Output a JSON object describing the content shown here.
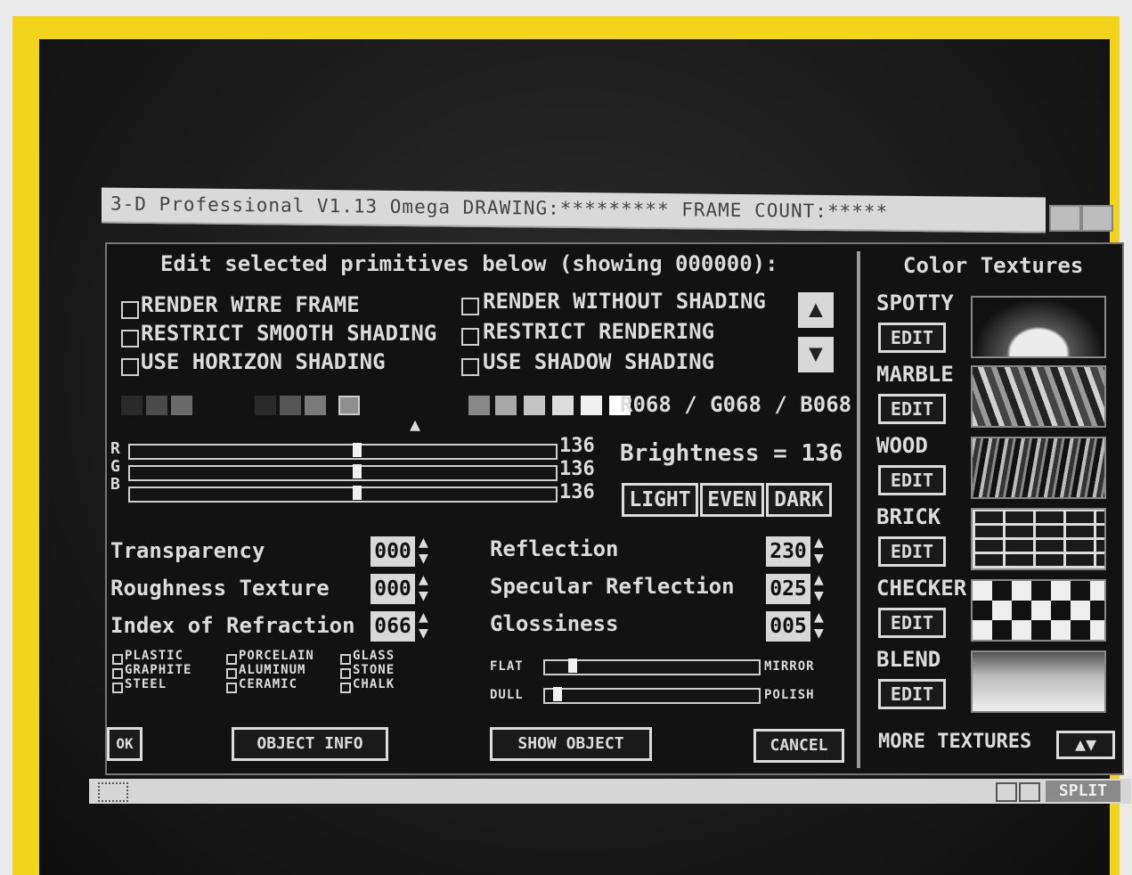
{
  "window": {
    "title": "3-D Professional V1.13 Omega  DRAWING:*********  FRAME COUNT:*****"
  },
  "header": "Edit selected primitives below (showing 000000):",
  "render_options": [
    {
      "label": "RENDER WIRE FRAME",
      "checked": false
    },
    {
      "label": "RESTRICT SMOOTH SHADING",
      "checked": false
    },
    {
      "label": "USE HORIZON SHADING",
      "checked": false
    },
    {
      "label": "RENDER WITHOUT SHADING",
      "checked": false
    },
    {
      "label": "RESTRICT RENDERING",
      "checked": false
    },
    {
      "label": "USE SHADOW SHADING",
      "checked": false
    }
  ],
  "scroll_icons": [
    "up-arrow-icon",
    "down-arrow-icon"
  ],
  "color": {
    "rgb_readout": "R068 / G068 / B068",
    "channels": [
      {
        "letter": "R",
        "value": "136",
        "level": 0.533
      },
      {
        "letter": "G",
        "value": "136",
        "level": 0.533
      },
      {
        "letter": "B",
        "value": "136",
        "level": 0.533
      }
    ],
    "brightness": "Brightness = 136",
    "buttons": [
      "LIGHT",
      "EVEN",
      "DARK"
    ],
    "swatches": [
      "#2a2a2a",
      "#4a4a4a",
      "#6a6a6a",
      "#2a2a2a",
      "#555555",
      "#7a7a7a",
      "#8e8e8e",
      "#121212",
      "#888888",
      "#a8a8a8",
      "#c4c4c4",
      "#dcdcdc",
      "#efefef",
      "#ffffff"
    ]
  },
  "properties_left": [
    {
      "label": "Transparency",
      "value": "000"
    },
    {
      "label": "Roughness Texture",
      "value": "000"
    },
    {
      "label": "Index of Refraction",
      "value": "066"
    }
  ],
  "properties_right": [
    {
      "label": "Reflection",
      "value": "230"
    },
    {
      "label": "Specular Reflection",
      "value": "025"
    },
    {
      "label": "Glossiness",
      "value": "005"
    }
  ],
  "materials": [
    [
      "PLASTIC",
      "GRAPHITE",
      "STEEL"
    ],
    [
      "PORCELAIN",
      "ALUMINUM",
      "CERAMIC"
    ],
    [
      "GLASS",
      "STONE",
      "CHALK"
    ]
  ],
  "finish_sliders": [
    {
      "left": "FLAT",
      "right": "MIRROR",
      "level": 0.1
    },
    {
      "left": "DULL",
      "right": "POLISH",
      "level": 0.03
    }
  ],
  "footer_buttons": {
    "ok": "OK",
    "object_info": "OBJECT INFO",
    "show_object": "SHOW OBJECT",
    "cancel": "CANCEL"
  },
  "textures": {
    "title": "Color Textures",
    "items": [
      {
        "name": "SPOTTY",
        "edit": "EDIT"
      },
      {
        "name": "MARBLE",
        "edit": "EDIT"
      },
      {
        "name": "WOOD",
        "edit": "EDIT"
      },
      {
        "name": "BRICK",
        "edit": "EDIT"
      },
      {
        "name": "CHECKER",
        "edit": "EDIT"
      },
      {
        "name": "BLEND",
        "edit": "EDIT"
      }
    ],
    "more": "MORE TEXTURES"
  },
  "bottom_bar": {
    "split": "SPLIT"
  }
}
